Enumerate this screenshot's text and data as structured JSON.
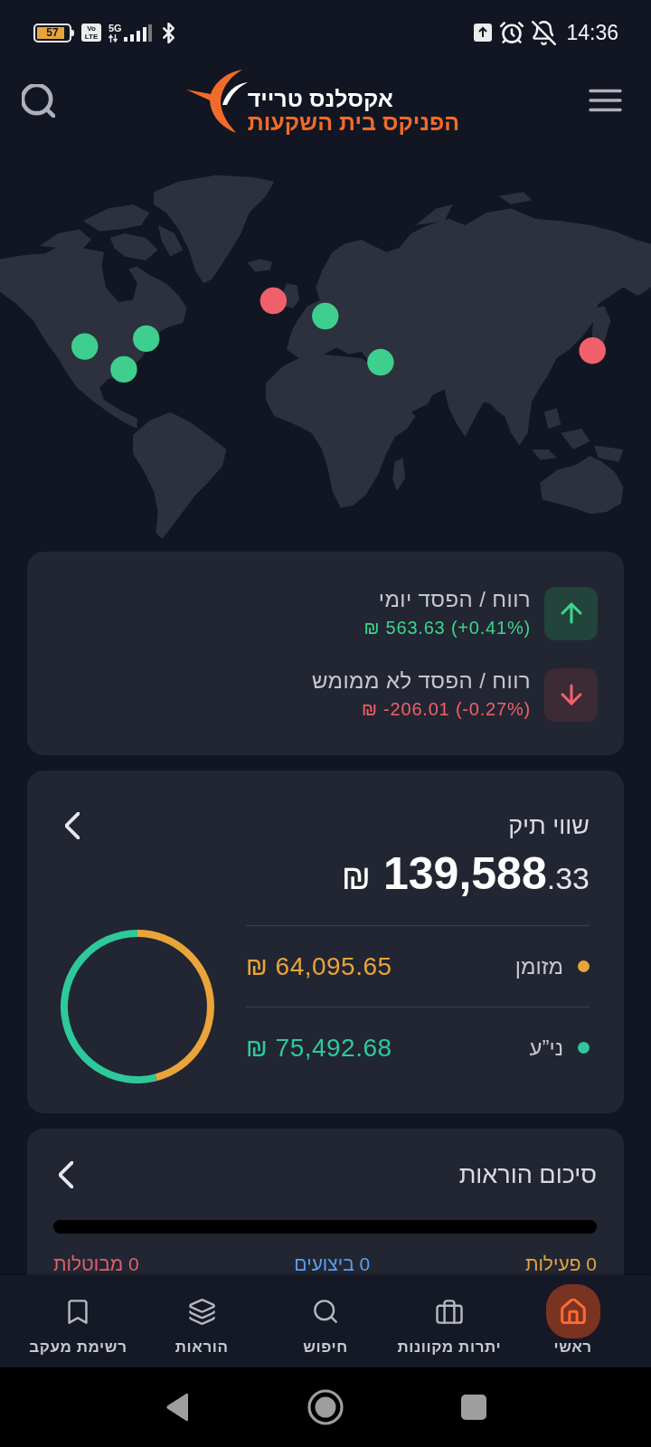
{
  "status_bar": {
    "battery": "57",
    "volte": [
      "Vo",
      "LTE"
    ],
    "network": "5G",
    "time": "14:36"
  },
  "header": {
    "logo": {
      "title": "אקסלנס טרייד",
      "subtitle": "הפניקס בית השקעות"
    }
  },
  "map": {
    "markers": [
      {
        "color": "#3ecf8e"
      },
      {
        "color": "#3ecf8e"
      },
      {
        "color": "#3ecf8e"
      },
      {
        "color": "#f0606c"
      },
      {
        "color": "#3ecf8e"
      },
      {
        "color": "#3ecf8e"
      },
      {
        "color": "#f0606c"
      }
    ]
  },
  "pnl_card": {
    "rows": [
      {
        "kind": "gain",
        "label": "רווח / הפסד יומי",
        "value": "₪ 563.63 (+0.41%)"
      },
      {
        "kind": "loss",
        "label": "רווח / הפסד לא ממומש",
        "value": "₪ -206.01 (-0.27%)"
      }
    ]
  },
  "portfolio_card": {
    "title": "שווי תיק",
    "total": {
      "currency": "₪",
      "integer": "139,588",
      "decimals": ".33"
    },
    "legend": [
      {
        "label": "מזומן",
        "value": "₪ 64,095.65",
        "color": "#e9a43a"
      },
      {
        "label": "ני”ע",
        "value": "₪ 75,492.68",
        "color": "#2ec99b"
      }
    ],
    "chart_data": {
      "type": "donut",
      "values": [
        45.92,
        54.08
      ]
    }
  },
  "orders_card": {
    "title": "סיכום הוראות",
    "counts": [
      {
        "label": "0 פעילות",
        "color": "#e9a43a"
      },
      {
        "label": "0 ביצועים",
        "color": "#5b9ff0"
      },
      {
        "label": "0 מבוטלות",
        "color": "#e0606a"
      }
    ]
  },
  "bottom_nav": [
    {
      "kind": "home",
      "label": "ראשי",
      "selected": true
    },
    {
      "kind": "accounts",
      "label": "יתרות מקוונות",
      "selected": false
    },
    {
      "kind": "search",
      "label": "חיפוש",
      "selected": false
    },
    {
      "kind": "orders",
      "label": "הוראות",
      "selected": false
    },
    {
      "kind": "watchlist",
      "label": "רשימת מעקב",
      "selected": false
    }
  ]
}
